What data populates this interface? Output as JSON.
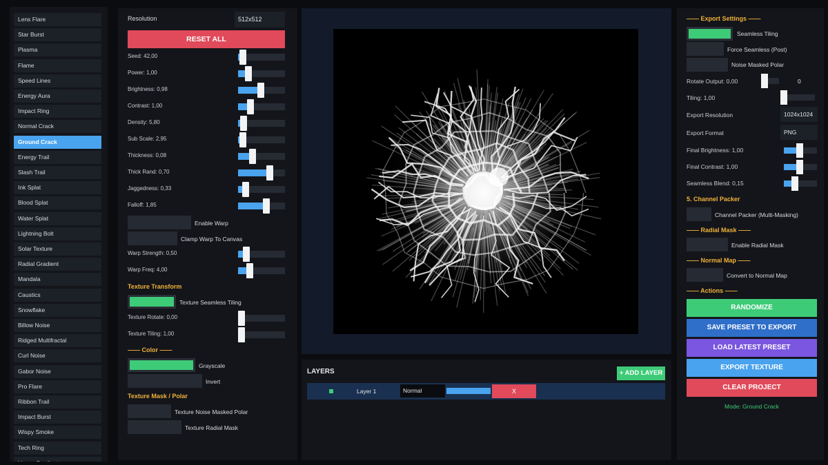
{
  "presets": {
    "items": [
      "Lens Flare",
      "Star Burst",
      "Plasma",
      "Flame",
      "Speed Lines",
      "Energy Aura",
      "Impact Ring",
      "Normal Crack",
      "Ground Crack",
      "Energy Trail",
      "Slash Trail",
      "Ink Splat",
      "Blood Splat",
      "Water Splat",
      "Lightning Bolt",
      "Solar Texture",
      "Radial Gradient",
      "Mandala",
      "Caustics",
      "Snowflake",
      "Billow Noise",
      "Ridged Multifractal",
      "Curl Noise",
      "Gabor Noise",
      "Pro Flare",
      "Ribbon Trail",
      "Impact Burst",
      "Wispy Smoke",
      "Tech Ring",
      "Linear Gradient"
    ],
    "active": "Ground Crack"
  },
  "params": {
    "resolution_label": "Resolution",
    "resolution_value": "512x512",
    "reset_label": "RESET ALL",
    "sliders": [
      {
        "label": "Seed: 42,00",
        "value": 0.04
      },
      {
        "label": "Power: 1,00",
        "value": 0.18
      },
      {
        "label": "Brightness: 0,98",
        "value": 0.49
      },
      {
        "label": "Contrast: 1,00",
        "value": 0.22
      },
      {
        "label": "Density: 5,80",
        "value": 0.06
      },
      {
        "label": "Sub Scale: 2,95",
        "value": 0.03
      },
      {
        "label": "Thickness: 0,08",
        "value": 0.27
      },
      {
        "label": "Thick Rand: 0,70",
        "value": 0.7
      },
      {
        "label": "Jaggedness: 0,33",
        "value": 0.1
      },
      {
        "label": "Falloff: 1,85",
        "value": 0.62
      }
    ],
    "toggles": [
      {
        "label": "Enable Warp",
        "on": false
      },
      {
        "label": "Clamp Warp To Canvas",
        "on": false
      }
    ],
    "warp_sliders": [
      {
        "label": "Warp Strength: 0,50",
        "value": 0.12
      },
      {
        "label": "Warp Freq: 4,00",
        "value": 0.2
      }
    ],
    "texture_transform_head": "Texture Transform",
    "seamless_toggle": {
      "label": "Texture Seamless Tiling",
      "on": true
    },
    "transform_sliders": [
      {
        "label": "Texture Rotate: 0,00",
        "value": 0.0
      },
      {
        "label": "Texture Tiling: 1,00",
        "value": 0.0
      }
    ],
    "color_head": "—— Color ——",
    "color_toggles": [
      {
        "label": "Grayscale",
        "on": true
      },
      {
        "label": "Invert",
        "on": false
      }
    ],
    "mask_head": "Texture Mask / Polar",
    "mask_toggles": [
      {
        "label": "Texture Noise Masked Polar",
        "on": false
      },
      {
        "label": "Texture Radial Mask",
        "on": false
      }
    ]
  },
  "layers": {
    "title": "LAYERS",
    "add_label": "+ ADD LAYER",
    "rows": [
      {
        "name": "Layer 1",
        "blend": "Normal",
        "opacity": 1.0,
        "delete_label": "X"
      }
    ]
  },
  "right": {
    "export_head": "—— Export Settings ——",
    "export_toggles": [
      {
        "label": "Seamless Tiling",
        "on": true
      },
      {
        "label": "Force Seamless (Post)",
        "on": false
      },
      {
        "label": "Noise Masked Polar",
        "on": false
      }
    ],
    "rotate_label": "Rotate Output: 0,00",
    "rotate_value": "0",
    "tiling_label": "Tiling: 1,00",
    "export_res_label": "Export Resolution",
    "export_res_value": "1024x1024",
    "export_format_label": "Export Format",
    "export_format_value": "PNG",
    "final_sliders": [
      {
        "label": "Final Brightness: 1,00",
        "value": 0.48
      },
      {
        "label": "Final Contrast: 1,00",
        "value": 0.48
      },
      {
        "label": "Seamless Blend: 0,15",
        "value": 0.28
      }
    ],
    "channel_head": "5. Channel Packer",
    "channel_toggle": {
      "label": "Channel Packer (Multi-Masking)",
      "on": false
    },
    "radial_head": "—— Radial Mask ——",
    "radial_toggle": {
      "label": "Enable Radial Mask",
      "on": false
    },
    "normal_head": "—— Normal Map ——",
    "normal_toggle": {
      "label": "Convert to Normal Map",
      "on": false
    },
    "actions_head": "—— Actions ——",
    "actions": [
      {
        "label": "RANDOMIZE",
        "color": "#3ecb78"
      },
      {
        "label": "SAVE PRESET TO EXPORT",
        "color": "#2f6fc9"
      },
      {
        "label": "LOAD LATEST PRESET",
        "color": "#7b56e0"
      },
      {
        "label": "EXPORT TEXTURE",
        "color": "#4aa3ee"
      },
      {
        "label": "CLEAR PROJECT",
        "color": "#e04a5a"
      }
    ],
    "mode_text": "Mode: Ground Crack"
  },
  "colors": {
    "accent_blue": "#4aa3ee",
    "accent_green": "#3ecb78",
    "accent_red": "#e04a5a",
    "section_orange": "#f0b13a"
  }
}
